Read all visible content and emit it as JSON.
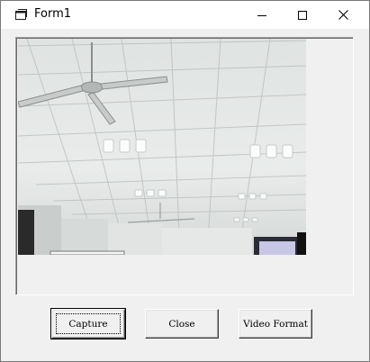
{
  "window": {
    "title": "Form1",
    "icon": "form-window-icon",
    "controls": [
      "minimize-icon",
      "maximize-icon",
      "close-icon"
    ]
  },
  "video": {
    "content": "webcam-preview-ceiling"
  },
  "buttons": {
    "capture_label": "Capture",
    "close_label": "Close",
    "video_format_label": "Video Format"
  },
  "colors": {
    "window_bg": "#f0f0f0",
    "titlebar_bg": "#ffffff"
  }
}
